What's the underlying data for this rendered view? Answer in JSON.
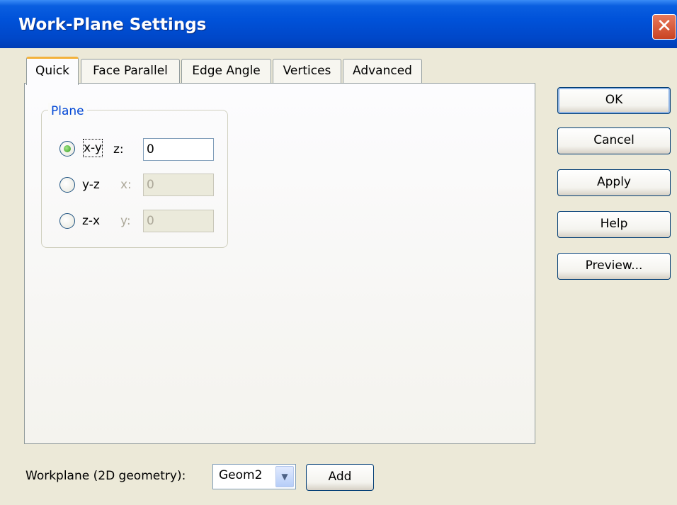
{
  "window": {
    "title": "Work-Plane Settings",
    "close_glyph": "✕"
  },
  "tabs": [
    {
      "label": "Quick",
      "active": true
    },
    {
      "label": "Face Parallel",
      "active": false
    },
    {
      "label": "Edge Angle",
      "active": false
    },
    {
      "label": "Vertices",
      "active": false
    },
    {
      "label": "Advanced",
      "active": false
    }
  ],
  "plane_group": {
    "title": "Plane",
    "options": [
      {
        "label": "x-y",
        "coord_label": "z:",
        "value": "0",
        "selected": true,
        "enabled": true
      },
      {
        "label": "y-z",
        "coord_label": "x:",
        "value": "0",
        "selected": false,
        "enabled": false
      },
      {
        "label": "z-x",
        "coord_label": "y:",
        "value": "0",
        "selected": false,
        "enabled": false
      }
    ]
  },
  "buttons": {
    "ok": "OK",
    "cancel": "Cancel",
    "apply": "Apply",
    "help": "Help",
    "preview": "Preview..."
  },
  "bottom": {
    "workplane_label": "Workplane (2D geometry):",
    "workplane_value": "Geom2",
    "add_label": "Add"
  },
  "colors": {
    "title_bar": "#0052d9",
    "dialog_bg": "#ece9d8",
    "group_title": "#0046d5",
    "active_tab_accent": "#f3b23c",
    "close_button": "#c94322"
  },
  "icons": {
    "close": "close-icon",
    "combo_arrow": "chevron-down-icon"
  }
}
